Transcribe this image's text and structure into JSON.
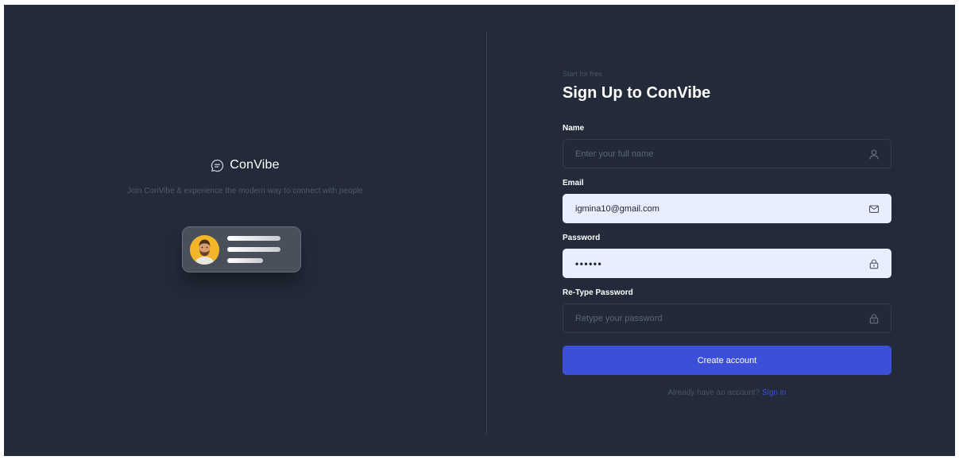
{
  "brand": {
    "name": "ConVibe",
    "tagline": "Join ConVibe & experience the modern way to connect with people",
    "logo_icon": "chat-bubble-icon"
  },
  "form": {
    "eyebrow": "Start for free",
    "title": "Sign Up to ConVibe",
    "name": {
      "label": "Name",
      "placeholder": "Enter your full name",
      "value": "",
      "icon": "user-icon"
    },
    "email": {
      "label": "Email",
      "placeholder": "",
      "value": "igmina10@gmail.com",
      "icon": "mail-icon"
    },
    "password": {
      "label": "Password",
      "value": "••••••",
      "icon": "lock-icon"
    },
    "retype": {
      "label": "Re-Type Password",
      "placeholder": "Retype your password",
      "value": "",
      "icon": "lock-icon"
    },
    "submit_label": "Create account",
    "signin_prompt": "Already have an account?",
    "signin_link": "Sign in"
  },
  "colors": {
    "background": "#232b3a",
    "accent": "#3b4fd8",
    "filled_input": "#e8eefb"
  }
}
